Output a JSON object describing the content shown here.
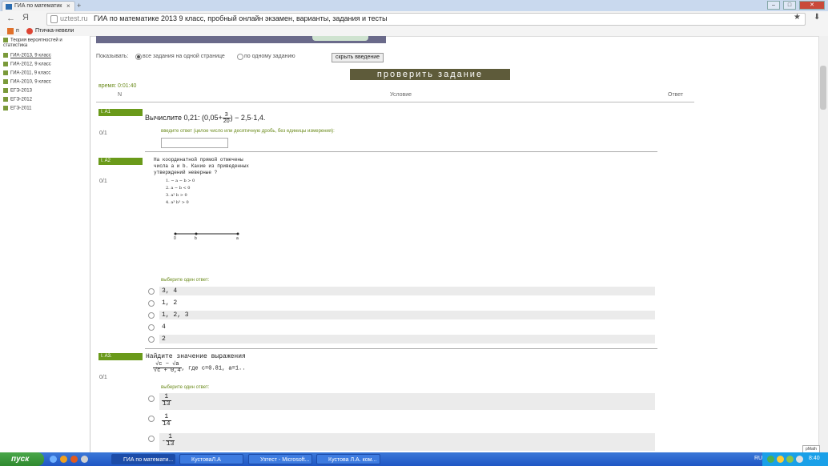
{
  "browser": {
    "tab_title": "ГИА по математик",
    "tab_close": "×",
    "new_tab": "+",
    "url_domain": "uztest.ru",
    "page_title": "ГИА по математике 2013 9 класс, пробный онлайн экзамен, варианты, задания и тесты",
    "yandex_letter": "Я",
    "back": "←",
    "star": "★",
    "download": "⬇"
  },
  "bookmarks": [
    {
      "label": "п"
    },
    {
      "label": "Птичка-невели"
    }
  ],
  "sidebar": {
    "items": [
      {
        "label": "Теория вероятностей и",
        "line2": "статистика",
        "underlined": false
      },
      {
        "label": "ГИА-2013, 9 класс",
        "underlined": true
      },
      {
        "label": "ГИА-2012, 9 класс",
        "underlined": false
      },
      {
        "label": "ГИА-2011, 9 класс",
        "underlined": false
      },
      {
        "label": "ГИА-2010, 9 класс",
        "underlined": false
      },
      {
        "label": "ЕГЭ-2013",
        "underlined": false
      },
      {
        "label": "ЕГЭ-2012",
        "underlined": false
      },
      {
        "label": "ЕГЭ-2011",
        "underlined": false
      }
    ]
  },
  "controls": {
    "show_label": "Показывать:",
    "opt_all": "все задания на одной странице",
    "opt_one": "по одному заданию",
    "hide_intro": "скрыть введение",
    "check": "проверить задание",
    "timer": "время: 0:01:40"
  },
  "table_header": {
    "n": "N",
    "cond": "Условие",
    "answer": "Ответ"
  },
  "questions": {
    "a1": {
      "tag": "I. A1",
      "score": "0/1",
      "text_pre": "Вычислите 0,21:",
      "paren_open": "(0,05+",
      "frac_num": "3",
      "frac_den": "20",
      "paren_close": ") − 2,5·1,4.",
      "hint": "введите ответ (целое число или десятичную дробь, без единицы измерения):"
    },
    "a2": {
      "tag": "I. A2",
      "score": "0/1",
      "lines": [
        "На координатной прямой отмечены",
        "числа a и b. Какие из приведенных",
        "утверждений неверные ?"
      ],
      "items": [
        "1.  − a − b > 0",
        "2.  a − b < 0",
        "3.  a² b > 0",
        "4.  a³ b³ > 0"
      ],
      "axis_labels": [
        "0",
        "b",
        "a"
      ],
      "hint": "выберите один ответ:",
      "options": [
        "3, 4",
        "1, 2",
        "1, 2, 3",
        "4",
        "2"
      ]
    },
    "a3": {
      "tag": "I. A3.",
      "score": "0/1",
      "title": "Найдите значение выражения",
      "expr_num": "√c − √a",
      "expr_den": "√c + 0,4",
      "expr_tail": ", где c=0.81, a=1..",
      "hint": "выберите один ответ:",
      "options": [
        {
          "sign": "",
          "num": "1",
          "den": "13"
        },
        {
          "sign": "",
          "num": "1",
          "den": "14"
        },
        {
          "sign": "-",
          "num": "1",
          "den": "13"
        }
      ]
    }
  },
  "pmath": "pMath",
  "taskbar": {
    "start": "пуск",
    "windows": [
      "ГИА по математи...",
      "КустоваЛ.А",
      "Узтест - Microsoft...",
      "Кустова Л.А. ком..."
    ],
    "lang": "RU",
    "clock": "8:40"
  }
}
